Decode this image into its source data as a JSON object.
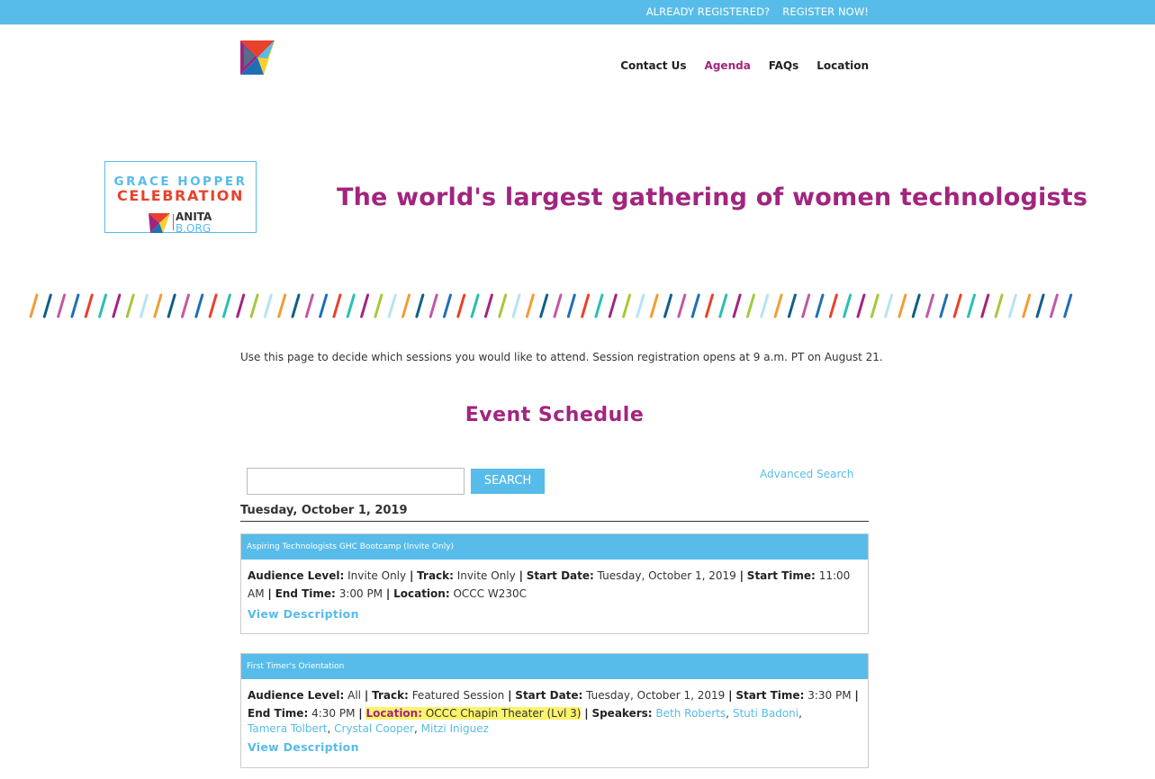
{
  "topbar": {
    "already_registered": "ALREADY REGISTERED?",
    "register_now": "REGISTER NOW!"
  },
  "nav": {
    "items": [
      {
        "label": "Contact Us",
        "active": false
      },
      {
        "label": "Agenda",
        "active": true
      },
      {
        "label": "FAQs",
        "active": false
      },
      {
        "label": "Location",
        "active": false
      }
    ]
  },
  "brand": {
    "ghc_line1": "GRACE HOPPER",
    "ghc_line2": "CELEBRATION",
    "anita_line1": "ANITA",
    "anita_line2": "B.ORG",
    "tagline": "The world's largest gathering of women technologists"
  },
  "intro_text": "Use this page to decide which sessions you would like to attend. Session registration opens at 9 a.m. PT on August 21.",
  "schedule": {
    "title": "Event Schedule",
    "search_value": "",
    "search_button": "SEARCH",
    "advanced_search": "Advanced Search",
    "day": "Tuesday, October 1, 2019",
    "labels": {
      "audience": "Audience Level:",
      "track": "Track:",
      "start_date": "Start Date:",
      "start_time": "Start Time:",
      "end_time": "End Time:",
      "location": "Location:",
      "speakers": "Speakers:",
      "view_description": "View Description"
    },
    "sessions": [
      {
        "title": "Aspiring Technologists GHC Bootcamp (Invite Only)",
        "audience": "Invite Only",
        "track": "Invite Only",
        "start_date": "Tuesday, October 1, 2019",
        "start_time": "11:00 AM",
        "end_time": "3:00 PM",
        "location": "OCCC W230C"
      },
      {
        "title": "First Timer's Orientation",
        "audience": "All",
        "track": "Featured Session",
        "start_date": "Tuesday, October 1, 2019",
        "start_time": "3:30 PM",
        "end_time": "4:30 PM",
        "location": "OCCC Chapin Theater (Lvl 3)",
        "speakers": [
          "Beth Roberts",
          "Stuti Badoni",
          "Tamera Tolbert",
          "Crystal Cooper",
          "Mitzi Iniguez"
        ]
      }
    ]
  },
  "colors": {
    "brand_blue": "#57bce9",
    "brand_magenta": "#a1257e",
    "highlight": "#fbf46a"
  }
}
